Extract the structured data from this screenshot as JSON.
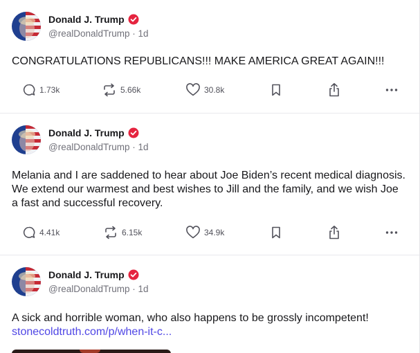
{
  "colors": {
    "brand_accent": "#e5243f",
    "link": "#4f46e5",
    "muted": "#71717a",
    "icon": "#52525b"
  },
  "posts": [
    {
      "author": "Donald J. Trump",
      "handle": "@realDonaldTrump",
      "separator": "·",
      "time": "1d",
      "text": "CONGRATULATIONS REPUBLICANS!!! MAKE AMERICA GREAT AGAIN!!!",
      "replies": "1.73k",
      "retruths": "5.66k",
      "likes": "30.8k"
    },
    {
      "author": "Donald J. Trump",
      "handle": "@realDonaldTrump",
      "separator": "·",
      "time": "1d",
      "text": "Melania and I are saddened to hear about Joe Biden’s recent medical diagnosis. We extend our warmest and best wishes to Jill and the family, and we wish Joe a fast and successful recovery.",
      "replies": "4.41k",
      "retruths": "6.15k",
      "likes": "34.9k"
    },
    {
      "author": "Donald J. Trump",
      "handle": "@realDonaldTrump",
      "separator": "·",
      "time": "1d",
      "text": "A sick and horrible woman, who also happens to be grossly incompetent!",
      "link": "stonecoldtruth.com/p/when-it-c..."
    }
  ],
  "icons": {
    "avatar": "avatar",
    "verified": "verified-badge-icon",
    "reply": "comment-icon",
    "retruth": "repost-icon",
    "like": "heart-icon",
    "bookmark": "bookmark-icon",
    "share": "share-icon",
    "more": "more-options-icon"
  }
}
